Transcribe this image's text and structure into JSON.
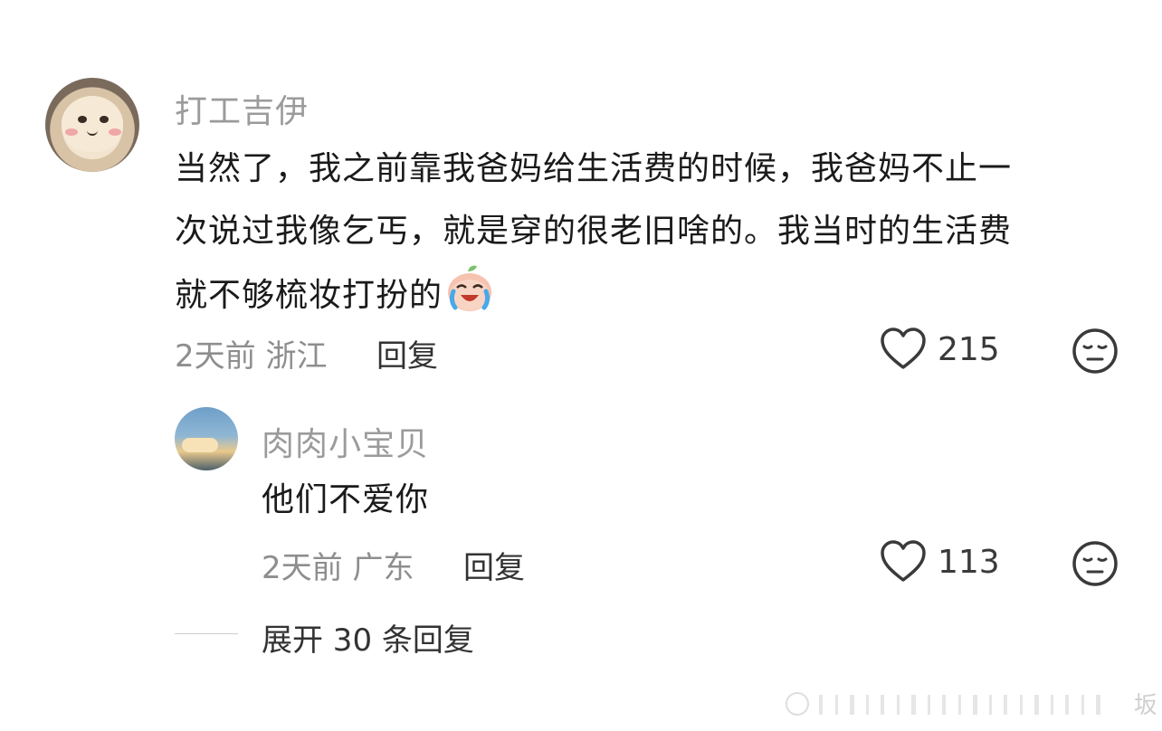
{
  "comment": {
    "author": "打工吉伊",
    "lines": [
      "当然了，我之前靠我爸妈给生活费的时候，我爸妈不止一",
      "次说过我像乞丐，就是穿的很老旧啥的。我当时的生活费",
      "就不够梳妆打扮的"
    ],
    "time": "2天前",
    "location": "浙江",
    "reply_label": "回复",
    "likes": "215"
  },
  "reply": {
    "author": "肉肉小宝贝",
    "text": "他们不爱你",
    "time": "2天前",
    "location": "广东",
    "reply_label": "回复",
    "likes": "113"
  },
  "expand_label": "展开 30 条回复",
  "watermark_char": "坂"
}
